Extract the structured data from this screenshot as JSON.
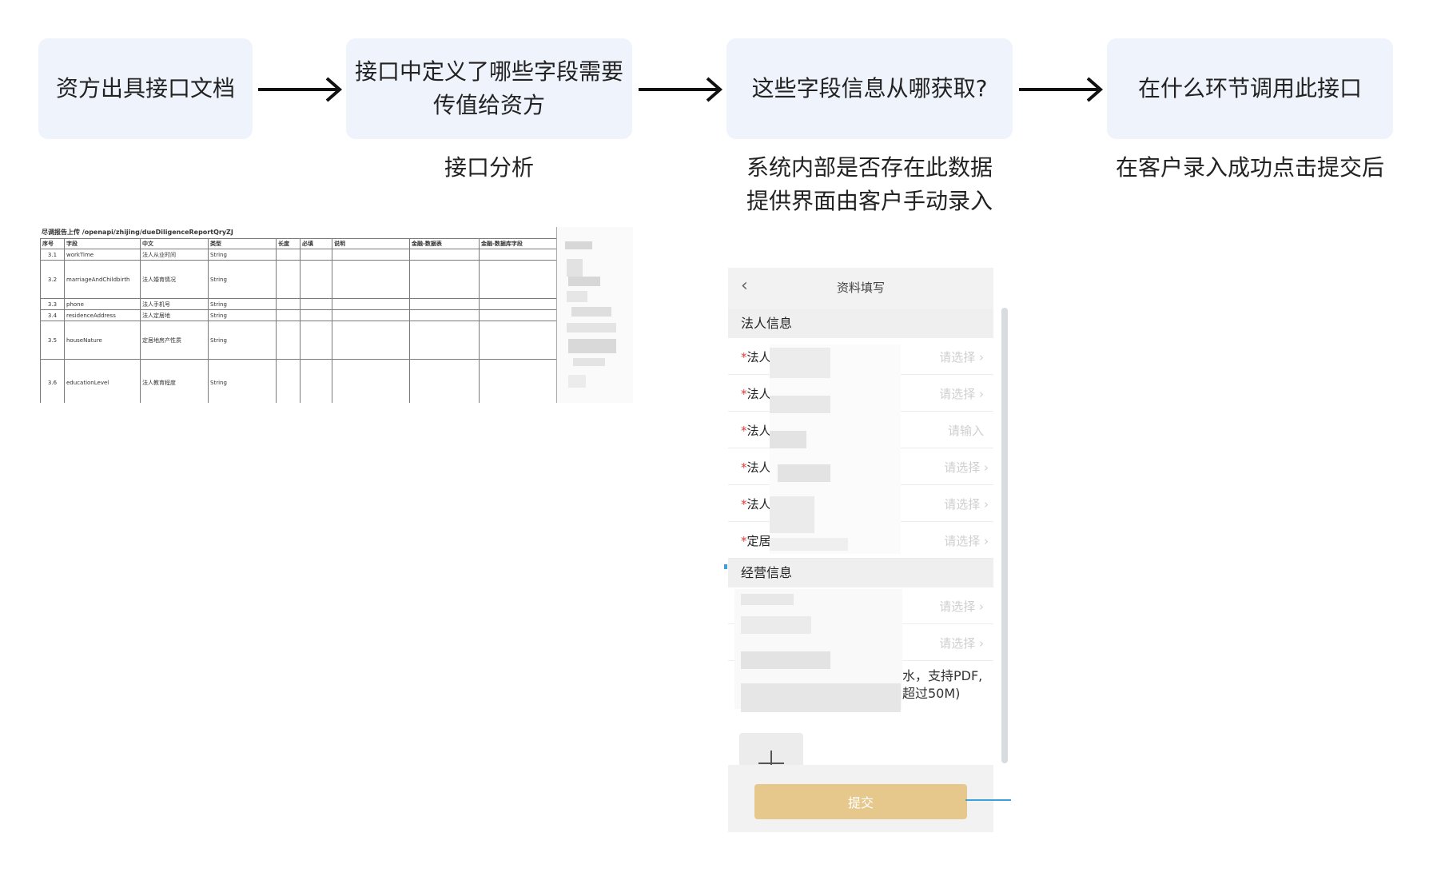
{
  "flow": {
    "step1": "资方出具接口文档",
    "step2_line1": "接口中定义了哪些字段需要",
    "step2_line2": "传值给资方",
    "step3": "这些字段信息从哪获取?",
    "step4": "在什么环节调用此接口"
  },
  "captions": {
    "step2": "接口分析",
    "step3_line1": "系统内部是否存在此数据",
    "step3_line2": "提供界面由客户手动录入",
    "step4": "在客户录入成功点击提交后"
  },
  "sheet": {
    "title": "尽调报告上传 /openapi/zhijing/dueDiligenceReportQryZJ",
    "headers": [
      "序号",
      "字段",
      "中文",
      "类型",
      "长度",
      "必填",
      "说明",
      "金融-数据表",
      "金融-数据库字段"
    ],
    "rows": [
      [
        "3.1",
        "workTime",
        "法人从业时间",
        "String"
      ],
      [
        "3.2",
        "marriageAndChildbirth",
        "法人婚育情况",
        "String"
      ],
      [
        "3.3",
        "phone",
        "法人手机号",
        "String"
      ],
      [
        "3.4",
        "residenceAddress",
        "法人定居地",
        "String"
      ],
      [
        "3.5",
        "houseNature",
        "定居地房产性质",
        "String"
      ],
      [
        "3.6",
        "educationLevel",
        "法人教育程度",
        "String"
      ]
    ]
  },
  "phone": {
    "title": "资料填写",
    "back_icon": "chevron-left",
    "section1": "法人信息",
    "fields": [
      {
        "req": "*",
        "label": "法人",
        "placeholder": "请选择"
      },
      {
        "req": "*",
        "label": "法人",
        "placeholder": "请选择"
      },
      {
        "req": "*",
        "label": "法人",
        "placeholder": "请输入"
      },
      {
        "req": "*",
        "label": "法人",
        "placeholder": "请选择"
      },
      {
        "req": "*",
        "label": "法人",
        "placeholder": "请选择"
      },
      {
        "req": "*",
        "label": "定居",
        "placeholder": "请选择"
      }
    ],
    "section2": "经营信息",
    "biz_fields": [
      {
        "placeholder": "请选择"
      },
      {
        "placeholder": "请选择"
      }
    ],
    "upload_note_line1": "水，支持PDF,",
    "upload_note_line2": "超过50M)",
    "plus_icon": "plus",
    "submit": "提交"
  },
  "colors": {
    "box_bg": "#eef3fc",
    "submit_bg": "#e6c88d",
    "connector": "#3aa1d9"
  }
}
